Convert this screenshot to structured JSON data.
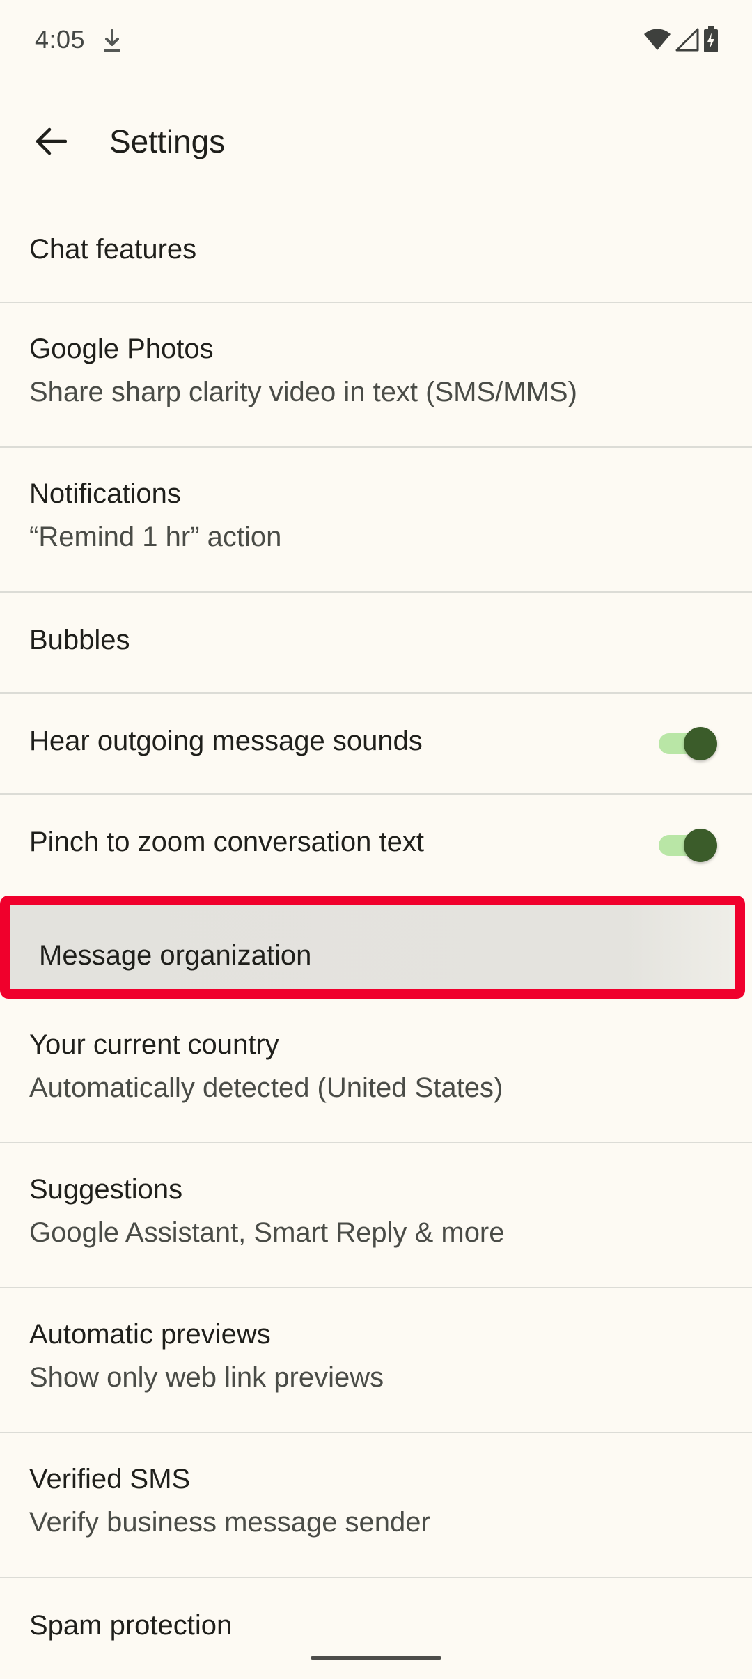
{
  "status_bar": {
    "time": "4:05",
    "icons": [
      "download-icon",
      "wifi-icon",
      "cell-signal-icon",
      "battery-charging-icon"
    ]
  },
  "header": {
    "title": "Settings",
    "back_icon": "arrow-back-icon"
  },
  "items": [
    {
      "title": "Chat features"
    },
    {
      "title": "Google Photos",
      "subtitle": "Share sharp clarity video in text (SMS/MMS)"
    },
    {
      "title": "Notifications",
      "subtitle": "“Remind 1 hr” action"
    },
    {
      "title": "Bubbles"
    },
    {
      "title": "Hear outgoing message sounds",
      "toggle": true
    },
    {
      "title": "Pinch to zoom conversation text",
      "toggle": true
    },
    {
      "title": "Message organization",
      "highlighted": true
    },
    {
      "title": "Your current country",
      "subtitle": "Automatically detected (United States)"
    },
    {
      "title": "Suggestions",
      "subtitle": "Google Assistant, Smart Reply & more"
    },
    {
      "title": "Automatic previews",
      "subtitle": "Show only web link previews"
    },
    {
      "title": "Verified SMS",
      "subtitle": "Verify business message sender"
    },
    {
      "title": "Spam protection"
    }
  ],
  "colors": {
    "background": "#fdfaf3",
    "highlight_border": "#f0002c",
    "toggle_track": "#b9e6a6",
    "toggle_thumb": "#3b5c2a"
  }
}
